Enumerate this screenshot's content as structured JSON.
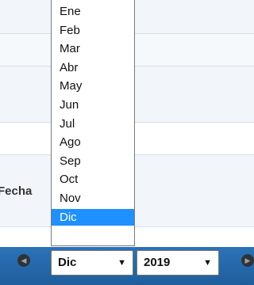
{
  "table": {
    "side_label": "Fecha"
  },
  "dropdown": {
    "options": [
      "Ene",
      "Feb",
      "Mar",
      "Abr",
      "May",
      "Jun",
      "Jul",
      "Ago",
      "Sep",
      "Oct",
      "Nov",
      "Dic"
    ],
    "selected_index": 11
  },
  "footer": {
    "month_select": {
      "value": "Dic",
      "arrow": "▼"
    },
    "year_select": {
      "value": "2019",
      "arrow": "▼"
    },
    "icons": {
      "prev": "chevron-left-icon",
      "next": "chevron-right-icon"
    }
  },
  "colors": {
    "footer_bar": "#1f5e9c",
    "selected_option": "#1e90ff",
    "row_stripe": "#f2f6fb"
  }
}
